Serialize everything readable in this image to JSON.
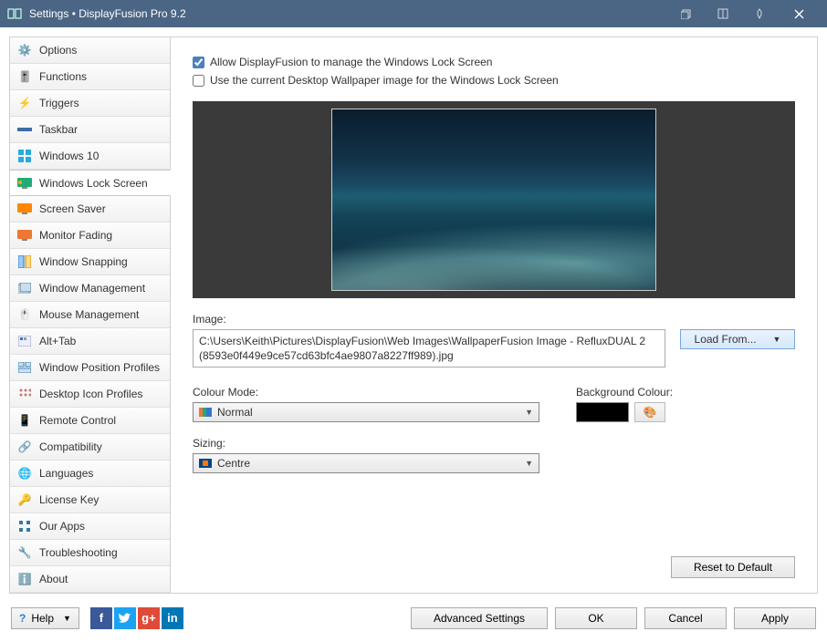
{
  "titlebar": {
    "title": "Settings • DisplayFusion Pro 9.2"
  },
  "sidebar": {
    "items": [
      {
        "label": "Options"
      },
      {
        "label": "Functions"
      },
      {
        "label": "Triggers"
      },
      {
        "label": "Taskbar"
      },
      {
        "label": "Windows 10"
      },
      {
        "label": "Windows Lock Screen"
      },
      {
        "label": "Screen Saver"
      },
      {
        "label": "Monitor Fading"
      },
      {
        "label": "Window Snapping"
      },
      {
        "label": "Window Management"
      },
      {
        "label": "Mouse Management"
      },
      {
        "label": "Alt+Tab"
      },
      {
        "label": "Window Position Profiles"
      },
      {
        "label": "Desktop Icon Profiles"
      },
      {
        "label": "Remote Control"
      },
      {
        "label": "Compatibility"
      },
      {
        "label": "Languages"
      },
      {
        "label": "License Key"
      },
      {
        "label": "Our Apps"
      },
      {
        "label": "Troubleshooting"
      },
      {
        "label": "About"
      }
    ]
  },
  "content": {
    "allow_manage_label": "Allow DisplayFusion to manage the Windows Lock Screen",
    "use_current_label": "Use the current Desktop Wallpaper image for the Windows Lock Screen",
    "image_label": "Image:",
    "image_path": "C:\\Users\\Keith\\Pictures\\DisplayFusion\\Web Images\\WallpaperFusion Image - RefluxDUAL 2 (8593e0f449e9ce57cd63bfc4ae9807a8227ff989).jpg",
    "load_from_label": "Load From...",
    "colour_mode_label": "Colour Mode:",
    "colour_mode_value": "Normal",
    "sizing_label": "Sizing:",
    "sizing_value": "Centre",
    "bg_colour_label": "Background Colour:",
    "bg_colour_value": "#000000",
    "reset_label": "Reset to Default"
  },
  "footer": {
    "help_label": "Help",
    "advanced_label": "Advanced Settings",
    "ok_label": "OK",
    "cancel_label": "Cancel",
    "apply_label": "Apply"
  }
}
